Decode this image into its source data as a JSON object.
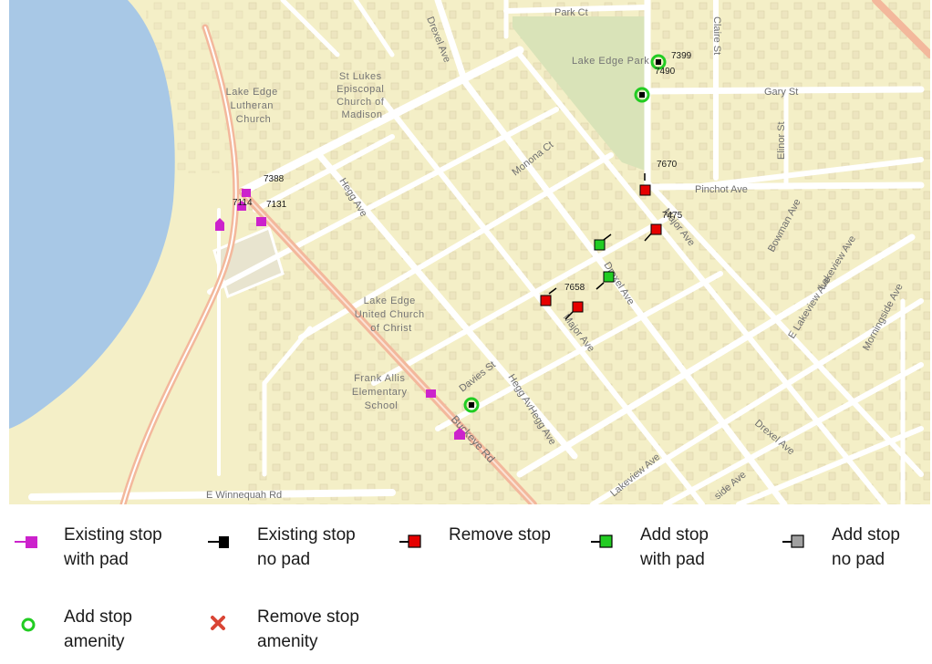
{
  "map": {
    "streets": {
      "park_ct": "Park Ct",
      "claire_st": "Claire St",
      "gary_st": "Gary St",
      "elinor_st": "Elinor St",
      "pinchot_ave": "Pinchot Ave",
      "drexel_ave_top": "Drexel Ave",
      "drexel_ave_mid": "Drexel Ave",
      "drexel_ave_bottom": "Drexel Ave",
      "monona_ct": "Monona Ct",
      "hegg_ave_top": "Hegg Ave",
      "hegg_ave_bottom": "Hegg AvHegg Ave",
      "major_ave_top": "Major Ave",
      "major_ave_bottom": "Major Ave",
      "bowman_ave": "Bowman Ave",
      "e_lakeview_ave": "E Lakeview Ave",
      "lakeview_ave_small": "Lakeview Ave",
      "lakeview_ave_bottom": "Lakeview Ave",
      "morningside_ave_right": "Morningside Ave",
      "morningside_ave_bottom": "side Ave",
      "davies_st": "Davies St",
      "buckeye_rd": "Buckeye Rd",
      "e_winnequah_rd": "E Winnequah Rd"
    },
    "places": {
      "lake_edge_lutheran": [
        "Lake Edge",
        "Lutheran",
        "Church"
      ],
      "st_lukes": [
        "St Lukes",
        "Episcopal",
        "Church of",
        "Madison"
      ],
      "lake_edge_ucc": [
        "Lake Edge",
        "United Church",
        "of Christ"
      ],
      "frank_allis": [
        "Frank Allis",
        "Elementary",
        "School"
      ],
      "lake_edge_park": "Lake Edge Park"
    },
    "stop_ids": {
      "s7399": "7399",
      "s7490": "7490",
      "s7670": "7670",
      "s7475": "7475",
      "s7388": "7388",
      "s7114": "7114",
      "s7131": "7131",
      "s7658": "7658"
    },
    "colors": {
      "land": "#f4efc7",
      "water": "#a8c8e6",
      "park": "#d9e3b8",
      "road": "#ffffff",
      "arterial": "#f3b89c",
      "building": "#ede6c2"
    }
  },
  "legend": {
    "existing_pad": "Existing stop\nwith pad",
    "existing_nopad": "Existing stop\nno pad",
    "remove_stop": "Remove stop",
    "add_pad": "Add stop\nwith pad",
    "add_nopad": "Add stop\nno pad",
    "add_amenity": "Add stop\namenity",
    "remove_amenity": "Remove stop\namenity",
    "colors": {
      "existing_pad": "#cc22cc",
      "existing_nopad": "#000000",
      "remove_stop": "#e60000",
      "add_pad": "#22cc22",
      "add_nopad": "#a0a0a0",
      "add_amenity": "#22cc22",
      "remove_amenity": "#d94535"
    }
  }
}
